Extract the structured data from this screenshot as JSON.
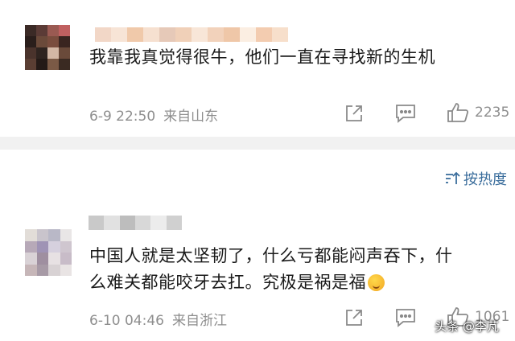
{
  "comments": [
    {
      "text": "我靠我真觉得很牛，他们一直在寻找新的生机",
      "time": "6-9 22:50",
      "location": "来自山东",
      "likes": "2235"
    },
    {
      "text_line1": "中国人就是太坚韧了，什么亏都能闷声吞下，什",
      "text_line2": "么难关都能咬牙去扛。究极是祸是福",
      "time": "6-10 04:46",
      "location": "来自浙江",
      "likes": "1061"
    }
  ],
  "sort": {
    "label": "按热度"
  },
  "watermark": {
    "label": "头条 @李芃"
  },
  "icons": {
    "share": "share-icon",
    "reply": "comment-icon",
    "like": "thumbs-up-icon",
    "sort": "sort-icon",
    "emoji": "emoji-face-icon"
  }
}
